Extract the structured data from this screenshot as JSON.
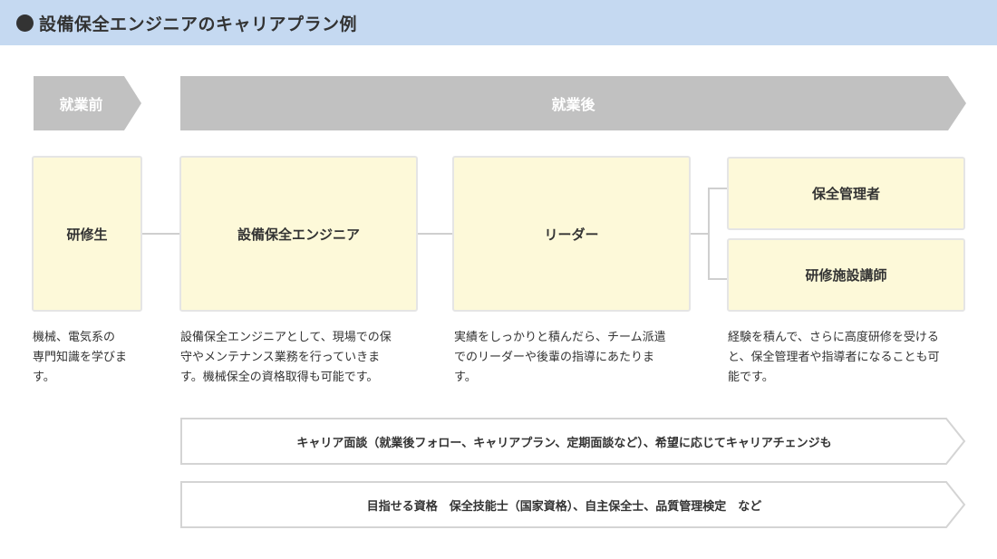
{
  "header": {
    "title": "設備保全エンジニアのキャリアプラン例"
  },
  "phases": {
    "before": "就業前",
    "after": "就業後"
  },
  "boxes": {
    "trainee": "研修生",
    "engineer": "設備保全エンジニア",
    "leader": "リーダー",
    "manager": "保全管理者",
    "instructor": "研修施設講師"
  },
  "descriptions": {
    "trainee": [
      "機械、電気系の",
      "専門知識を学びま",
      "す。"
    ],
    "engineer": [
      "設備保全エンジニアとして、現場での保",
      "守やメンテナンス業務を行っていきま",
      "す。機械保全の資格取得も可能です。"
    ],
    "leader": [
      "実績をしっかりと積んだら、チーム派遣",
      "でのリーダーや後輩の指導にあたりま",
      "す。"
    ],
    "advanced": [
      "経験を積んで、さらに高度研修を受ける",
      "と、保全管理者や指導者になることも可",
      "能です。"
    ]
  },
  "banners": {
    "career": "キャリア面談（就業後フォロー、キャリアプラン、定期面談など）、希望に応じてキャリアチェンジも",
    "qualifications": "目指せる資格　保全技能士（国家資格）、自主保全士、品質管理検定　など"
  },
  "colors": {
    "header_bg": "#c5d9f1",
    "phase_bg": "#c1c1c1",
    "box_bg": "#fdf9d9",
    "box_border": "#e5e5e5",
    "connector": "#cfcfcf"
  }
}
